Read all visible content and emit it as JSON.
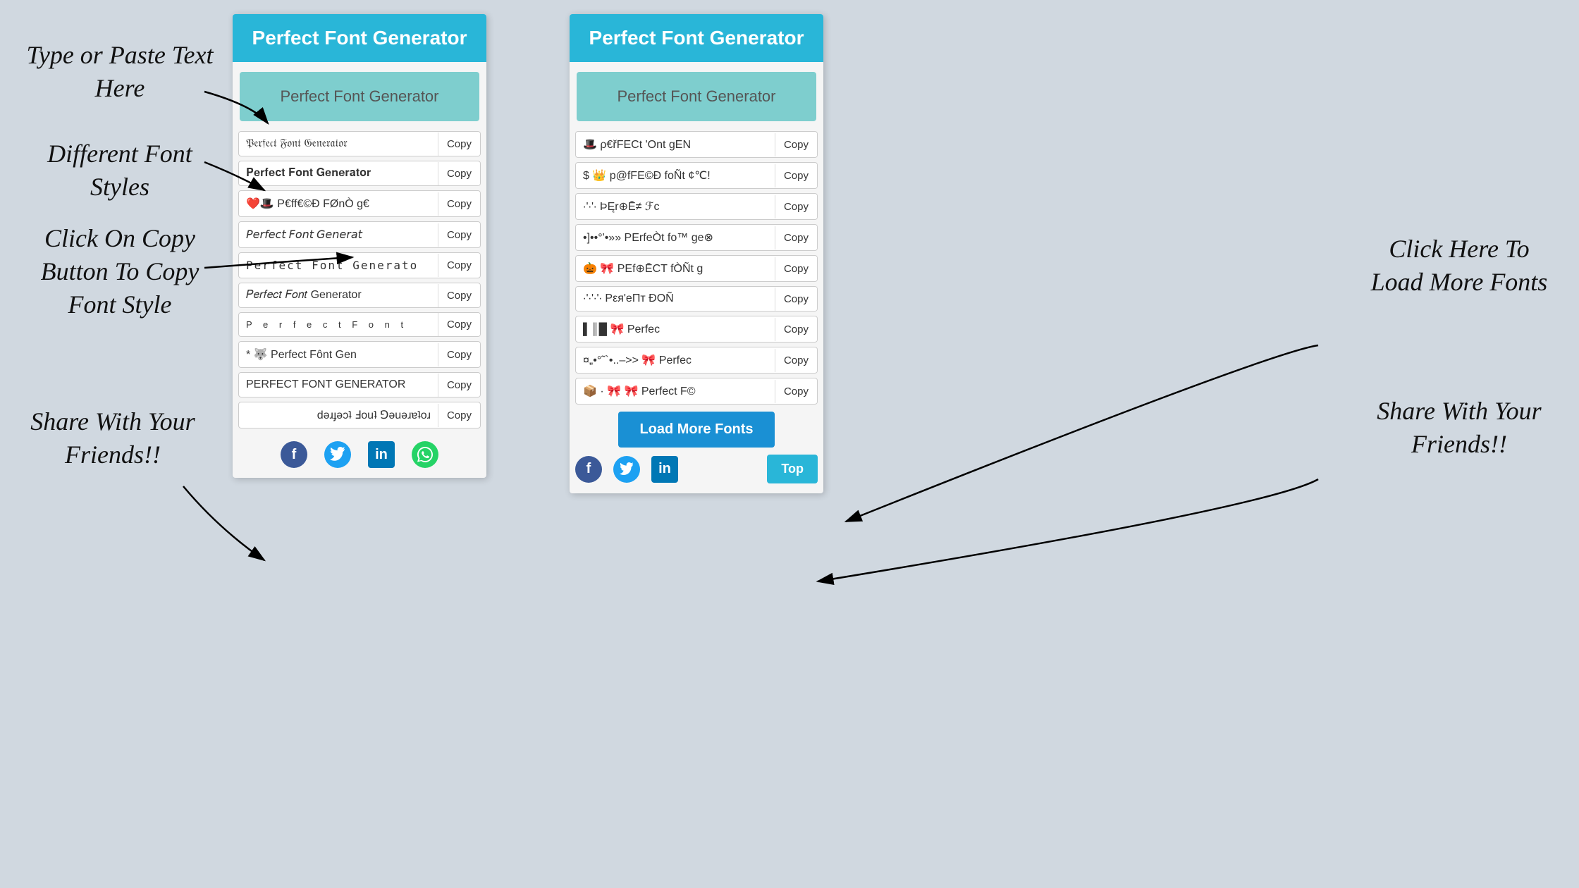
{
  "bg_color": "#d0d8e0",
  "annotations": {
    "type_paste": "Type or Paste Text\nHere",
    "diff_fonts": "Different Font\nStyles",
    "click_copy": "Click On Copy\nButton To Copy\nFont Style",
    "share": "Share With\nYour\nFriends!!",
    "load_more_label": "Click Here To\nLoad More\nFonts",
    "share_right": "Share With\nYour\nFriends!!"
  },
  "left_panel": {
    "header": "Perfect Font Generator",
    "input_placeholder": "Perfect Font Generator",
    "font_rows": [
      {
        "text": "𝔓𝔢𝔯𝔣𝔢𝔠𝔱 𝔉𝔬𝔫𝔱 𝔊𝔢𝔫𝔢𝔯𝔞𝔱𝔬𝔯",
        "copy": "Copy"
      },
      {
        "text": "𝐏𝐞𝐫𝐟𝐞𝐜𝐭 𝐅𝐨𝐧𝐭 𝐆𝐞𝐧𝐞𝐫𝐚𝐭𝐨𝐫",
        "copy": "Copy"
      },
      {
        "text": "❤️🎩 P€ff€©Ð FØnÒ g€",
        "copy": "Copy"
      },
      {
        "text": "𝘗𝘦𝘳𝘧𝘦𝘤𝘵 𝘍𝘰𝘯𝘵 𝘎𝘦𝘯𝘦𝘳𝘢𝘵",
        "copy": "Copy"
      },
      {
        "text": "𝙿𝚎𝚛𝚏𝚎𝚌𝚝 𝙵𝚘𝚗𝚝 𝙶𝚎𝚗𝚎𝚛𝚊𝚝𝚘",
        "copy": "Copy"
      },
      {
        "text": "𝑃𝑒𝑟𝑓𝑒𝑐𝑡 𝐹𝑜𝑛𝑡 Generator",
        "copy": "Copy"
      },
      {
        "text": "P  e  r  f  e  c  t   F  o  n  t",
        "copy": "Copy"
      },
      {
        "text": "* 🐺 Perfect Fônt Gen",
        "copy": "Copy"
      },
      {
        "text": "PERFECT FONT GENERATOR",
        "copy": "Copy"
      },
      {
        "text": "ɹoʇɐɹǝuǝ⅁ ʇuoℲ ʇɔǝɟɹǝd",
        "copy": "Copy"
      }
    ],
    "social": [
      "f",
      "🐦",
      "in",
      "📱"
    ]
  },
  "right_panel": {
    "header": "Perfect Font Generator",
    "input_placeholder": "Perfect Font Generator",
    "font_rows": [
      {
        "text": "🎩 ρ€řFECt 'Ont gEN",
        "copy": "Copy"
      },
      {
        "text": "$ 👑 p@fFE©Ð foÑt ¢℃!",
        "copy": "Copy"
      },
      {
        "text": "∙'∙'∙ ÞĘr⊕Ē≠ ℱc",
        "copy": "Copy"
      },
      {
        "text": "•]••°'•»» PErfeÒt fo™ ge⊗",
        "copy": "Copy"
      },
      {
        "text": "🎃 🎀 PEf⊕ĒCT fÒÑt g",
        "copy": "Copy"
      },
      {
        "text": "∙'∙'∙'∙ Pεя'eΠт ÐOÑ",
        "copy": "Copy"
      },
      {
        "text": "▌║█ 🎀 Perfec",
        "copy": "Copy"
      },
      {
        "text": "¤„•°˜`•..–>> 🎀 Perfec",
        "copy": "Copy"
      },
      {
        "text": "📦 · 🎀 🎀 Perfect F©",
        "copy": "Copy"
      }
    ],
    "load_more": "Load More Fonts",
    "top_btn": "Top",
    "social": [
      "f",
      "🐦",
      "in",
      ""
    ]
  }
}
